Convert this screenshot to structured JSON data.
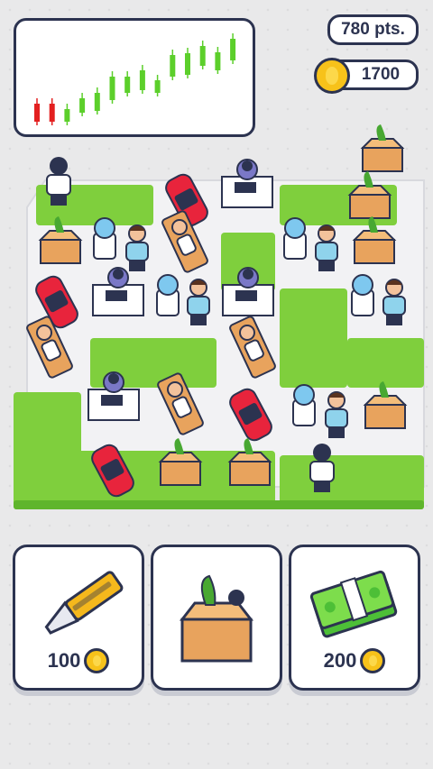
{
  "hud": {
    "points_label": "780 pts.",
    "coins_label": "1700"
  },
  "chart_data": {
    "type": "candlestick",
    "candles": [
      {
        "color": "red"
      },
      {
        "color": "red"
      },
      {
        "color": "green"
      },
      {
        "color": "green"
      },
      {
        "color": "green"
      },
      {
        "color": "green"
      },
      {
        "color": "green"
      },
      {
        "color": "green"
      },
      {
        "color": "green"
      },
      {
        "color": "green"
      },
      {
        "color": "green"
      },
      {
        "color": "green"
      },
      {
        "color": "green"
      },
      {
        "color": "green"
      }
    ],
    "colors": {
      "up": "#5ccf2b",
      "down": "#e32020"
    }
  },
  "shop": {
    "items": [
      {
        "name": "knife",
        "price": "100"
      },
      {
        "name": "office-box",
        "price": ""
      },
      {
        "name": "cash-stack",
        "price": "200"
      }
    ]
  },
  "colors": {
    "grass": "#7fcf3d",
    "tile": "#f2f2f4",
    "outline": "#2c3350",
    "coin": "#f7c21a"
  }
}
